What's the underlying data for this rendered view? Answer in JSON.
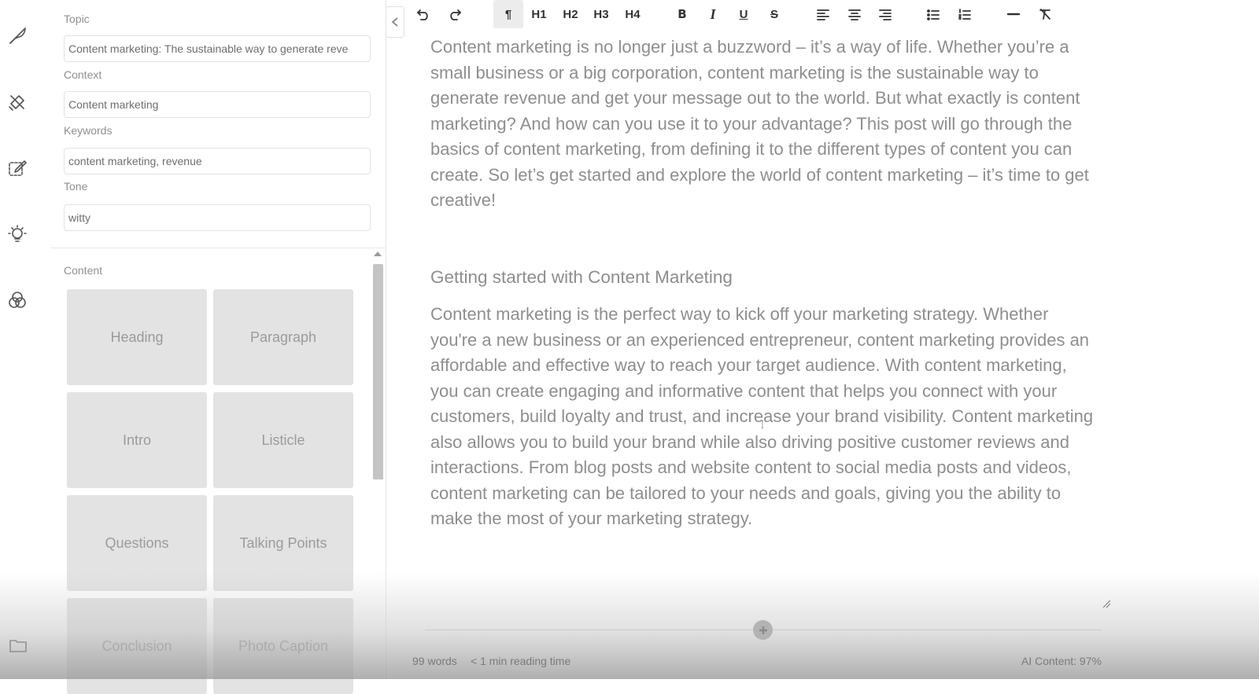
{
  "panel": {
    "topic": {
      "label": "Topic",
      "value": "Content marketing: The sustainable way to generate reve"
    },
    "context": {
      "label": "Context",
      "value": "Content marketing"
    },
    "keywords": {
      "label": "Keywords",
      "value": "content marketing, revenue"
    },
    "tone": {
      "label": "Tone",
      "value": "witty"
    },
    "content_label": "Content",
    "tiles": [
      "Heading",
      "Paragraph",
      "Intro",
      "Listicle",
      "Questions",
      "Talking Points",
      "Conclusion",
      "Photo Caption"
    ]
  },
  "toolbar": {
    "paragraph": "¶",
    "h1": "H1",
    "h2": "H2",
    "h3": "H3",
    "h4": "H4",
    "bold": "B",
    "italic": "I",
    "underline": "U",
    "strike": "S"
  },
  "editor": {
    "intro": "Content marketing is no longer just a buzzword – it’s a way of life. Whether you’re a small business or a big corporation, content marketing is the sustainable way to generate revenue and get your message out to the world. But what exactly is content marketing? And how can you use it to your advantage? This post will go through the basics of content marketing, from defining it to the different types of content you can create. So let’s get started and explore the world of content marketing – it’s time to get creative!",
    "heading": "Getting started with Content Marketing",
    "body": "Content marketing is the perfect way to kick off your marketing strategy. Whether you're a new business or an experienced entrepreneur, content marketing provides an affordable and effective way to reach your target audience. With content marketing, you can create engaging and informative content that helps you connect with your customers, build loyalty and trust, and increase your brand visibility. Content marketing also allows you to build your brand while also driving positive customer reviews and interactions. From blog posts and website content to social media posts and videos, content marketing can be tailored to your needs and goals, giving you the ability to make the most of your marketing strategy."
  },
  "status": {
    "words": "99 words",
    "reading": "< 1 min reading time",
    "ai": "AI Content: 97%"
  }
}
